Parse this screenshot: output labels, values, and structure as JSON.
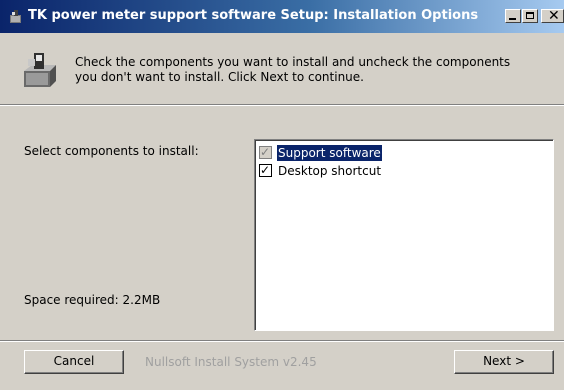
{
  "window": {
    "title": "TK power meter support software Setup: Installation Options",
    "minimize_icon": "minimize-icon",
    "maximize_icon": "maximize-icon",
    "close_icon": "close-icon"
  },
  "header": {
    "line1": "Check the components you want to install and uncheck the components",
    "line2": "you don't want to install. Click Next to continue.",
    "icon": "installer-box-icon"
  },
  "main": {
    "select_label": "Select components to install:",
    "space_label": "Space required: 2.2MB",
    "components": [
      {
        "label": "Support software",
        "checked": true,
        "disabled": true,
        "selected": true
      },
      {
        "label": "Desktop shortcut",
        "checked": true,
        "disabled": false,
        "selected": false
      }
    ]
  },
  "footer": {
    "cancel_label": "Cancel",
    "branding": "Nullsoft Install System v2.45",
    "next_label": "Next >"
  },
  "colors": {
    "titlebar_start": "#0a246a",
    "titlebar_end": "#a6caf0",
    "selection": "#0a246a",
    "face": "#d4d0c8"
  }
}
